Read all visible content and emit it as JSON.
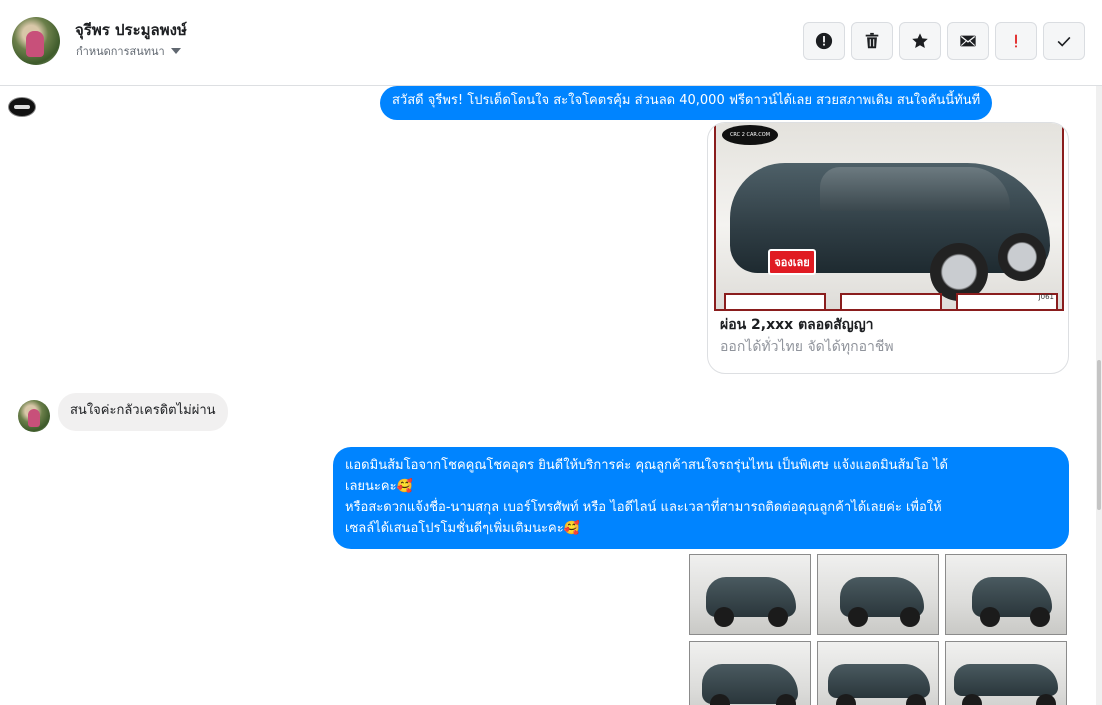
{
  "header": {
    "name": "จุรีพร ประมูลพงษ์",
    "label": "กำหนดการสนทนา"
  },
  "actions": [
    {
      "icon": "alert-circle-icon",
      "color": "#1c1e21"
    },
    {
      "icon": "trash-icon",
      "color": "#1c1e21"
    },
    {
      "icon": "star-icon",
      "color": "#1c1e21"
    },
    {
      "icon": "mail-icon",
      "color": "#1c1e21"
    },
    {
      "icon": "exclamation-icon",
      "color": "#e02020"
    },
    {
      "icon": "check-icon",
      "color": "#1c1e21"
    }
  ],
  "messages": {
    "promo": "สวัสดี จุรีพร! โปรเด็ดโดนใจ สะใจโคตรคุ้ม ส่วนลด 40,000 ฟรีดาวน์ได้เลย สวยสภาพเดิม สนใจคันนี้ทันที",
    "card": {
      "title": "ผ่อน 2,xxx ตลอดสัญญา",
      "subtitle": "ออกได้ทั่วไทย จัดได้ทุกอาชีพ",
      "plate": "จองเลย",
      "logo": "CRC 2 CAR.COM",
      "code": "J061"
    },
    "incoming": "สนใจค่ะกลัวเครดิตไม่ผ่าน",
    "reply_line1": "แอดมินส้มโอจากโชคคูณโชคอุดร ยินดีให้บริการค่ะ   คุณลูกค้าสนใจรถรุ่นไหน เป็นพิเศษ แจ้งแอดมินส้มโอ ได้",
    "reply_line2": "เลยนะคะ🥰",
    "reply_line3": "หรือสะดวกแจ้งชื่อ-นามสกุล เบอร์โทรศัพท์ หรือ ไอดีไลน์ และเวลาที่สามารถติดต่อคุณลูกค้าได้เลยค่ะ เพื่อให้",
    "reply_line4": "เซลล์ได้เสนอโปรโมชั่นดีๆเพิ่มเติมนะคะ🥰"
  },
  "colors": {
    "outgoing_bubble": "#0084ff",
    "incoming_bubble": "#f1f0f0"
  }
}
